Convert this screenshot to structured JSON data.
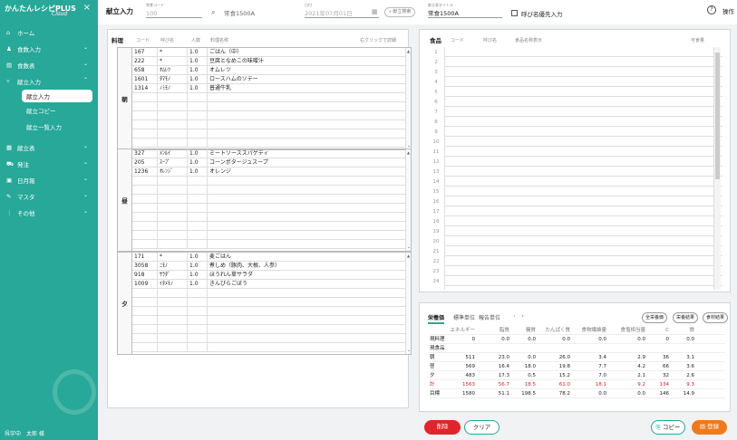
{
  "app": {
    "name": "かんたんレシピPLUS",
    "name_sub": "Cloud",
    "close_icon": "×"
  },
  "nav": [
    {
      "label": "ホーム",
      "icon": "home-icon",
      "chev": ""
    },
    {
      "label": "食数入力",
      "icon": "people-icon",
      "chev": "⌄"
    },
    {
      "label": "食数表",
      "icon": "document-icon",
      "chev": "⌄"
    },
    {
      "label": "献立入力",
      "icon": "utensils-icon",
      "chev": "⌃"
    }
  ],
  "nav_sub": [
    "献立入力",
    "献立コピー",
    "献立一覧入力"
  ],
  "nav2": [
    {
      "label": "献立表",
      "icon": "table-icon",
      "chev": "⌄"
    },
    {
      "label": "発注",
      "icon": "truck-icon",
      "chev": "⌄"
    },
    {
      "label": "日月報",
      "icon": "report-icon",
      "chev": "⌄"
    },
    {
      "label": "マスタ",
      "icon": "pencil-icon",
      "chev": "⌄"
    },
    {
      "label": "その他",
      "icon": "more-icon",
      "chev": "⌄"
    }
  ],
  "user": "呉宇中　太郎 様",
  "topbar": {
    "title": "献立入力",
    "code_label": "常食コード",
    "code_value": "100",
    "menu_label": "常食1500A",
    "date_label": "日付",
    "date_value": "2021年07月01日",
    "search_btn": "献立検索",
    "menu_title_label": "献立表タイトル",
    "menu_title_value": "常食1500A",
    "checkbox_label": "呼び名優先入力",
    "help_icon": "?",
    "hint": "操作"
  },
  "menu_panel": {
    "title": "料理",
    "cols": [
      "コード",
      "呼び名",
      "人数",
      "料理名称"
    ],
    "hint": "右クリックで詳細"
  },
  "meals": [
    {
      "label": "朝",
      "rows": [
        [
          "167",
          "*",
          "1.0",
          "ごはん（中）"
        ],
        [
          "222",
          "*",
          "1.0",
          "豆腐となめこの味噌汁"
        ],
        [
          "658",
          "ｵﾑﾚﾂ",
          "1.0",
          "オムレツ"
        ],
        [
          "1601",
          "ﾀﾏﾓﾉ",
          "1.0",
          "ロースハムのソテー"
        ],
        [
          "1314",
          "ﾉﾐﾓﾉ",
          "1.0",
          "普通牛乳"
        ]
      ]
    },
    {
      "label": "昼",
      "rows": [
        [
          "327",
          "ﾒﾝﾙｲ",
          "1.0",
          "ミートソーススパゲティ"
        ],
        [
          "205",
          "ｽｰﾌﾟ",
          "1.0",
          "コーンポタージュスープ"
        ],
        [
          "1236",
          "ｵﾚﾝｼﾞ",
          "1.0",
          "オレンジ"
        ]
      ]
    },
    {
      "label": "夕",
      "rows": [
        [
          "171",
          "*",
          "1.0",
          "麦ごはん"
        ],
        [
          "3058",
          "ﾆﾓﾉ",
          "1.0",
          "煮しめ（豚肉、大根、人参）"
        ],
        [
          "918",
          "ｻﾗﾀﾞ",
          "1.0",
          "ほうれん草サラダ"
        ],
        [
          "1009",
          "ｲﾀﾒﾓﾉ",
          "1.0",
          "きんぴらごぼう"
        ]
      ]
    }
  ],
  "food_panel": {
    "title": "食品",
    "cols": [
      "コード",
      "呼び名",
      "食品名称表示",
      "可食量"
    ],
    "row_numbers": [
      "1",
      "2",
      "3",
      "4",
      "5",
      "6",
      "7",
      "8",
      "9",
      "10",
      "11",
      "12",
      "13",
      "14",
      "15",
      "16",
      "17",
      "18",
      "19",
      "20",
      "21",
      "22",
      "23",
      "24"
    ]
  },
  "nutrition": {
    "tabs": [
      "栄養価",
      "標準単位",
      "報告単位"
    ],
    "buttons": [
      "全栄養価",
      "栄養結果",
      "食材結果"
    ],
    "cols": [
      "エネルギー",
      "脂質",
      "糖質",
      "たんぱく質",
      "食物繊維量",
      "食塩相当量",
      "C",
      "鉄"
    ],
    "rows": [
      {
        "label": "現料理",
        "values": [
          "0",
          "0.0",
          "0.0",
          "0.0",
          "0.0",
          "0.0",
          "0",
          "0.0"
        ],
        "red": false
      },
      {
        "label": "現食品",
        "values": [
          "",
          "",
          "",
          "",
          "",
          "",
          "",
          ""
        ],
        "red": false
      },
      {
        "label": "朝",
        "values": [
          "511",
          "23.0",
          "0.0",
          "26.0",
          "3.4",
          "2.9",
          "36",
          "3.1"
        ],
        "red": false
      },
      {
        "label": "昼",
        "values": [
          "569",
          "16.4",
          "18.0",
          "19.8",
          "7.7",
          "4.2",
          "66",
          "3.6"
        ],
        "red": false
      },
      {
        "label": "夕",
        "values": [
          "483",
          "17.3",
          "0.5",
          "15.2",
          "7.0",
          "2.1",
          "32",
          "2.6"
        ],
        "red": false
      },
      {
        "label": "計",
        "values": [
          "1563",
          "56.7",
          "18.5",
          "61.0",
          "18.1",
          "9.2",
          "134",
          "9.3"
        ],
        "red": true
      },
      {
        "label": "目標",
        "values": [
          "1580",
          "51.1",
          "198.5",
          "78.2",
          "0.0",
          "0.0",
          "146",
          "14.9"
        ],
        "red": false
      }
    ]
  },
  "actions": {
    "delete": "削除",
    "clear": "クリア",
    "copy": "コピー",
    "register": "登録"
  },
  "colors": {
    "sidebar": "#27a898",
    "delete": "#e0242b",
    "register": "#f07a1a",
    "red_text": "#dd2222"
  }
}
